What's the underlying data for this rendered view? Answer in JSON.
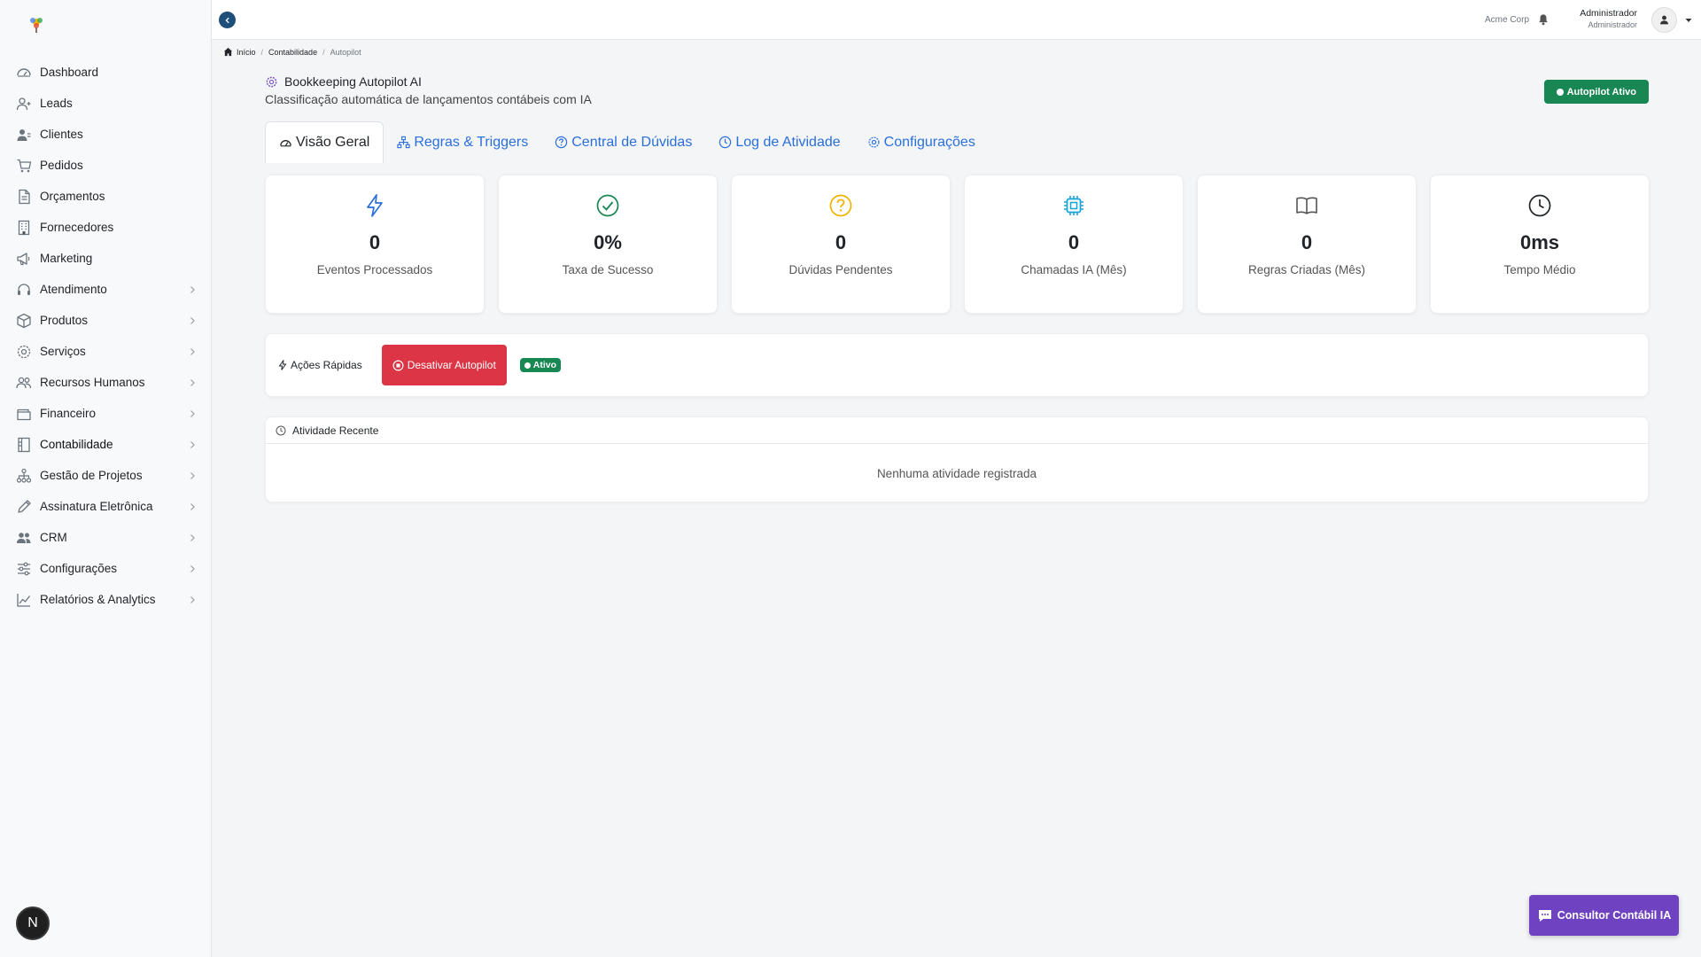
{
  "sidebar": {
    "items": [
      {
        "label": "Dashboard",
        "icon": "dashboard-icon",
        "has_submenu": false
      },
      {
        "label": "Leads",
        "icon": "user-plus-icon",
        "has_submenu": false
      },
      {
        "label": "Clientes",
        "icon": "users-icon",
        "has_submenu": false
      },
      {
        "label": "Pedidos",
        "icon": "cart-icon",
        "has_submenu": false
      },
      {
        "label": "Orçamentos",
        "icon": "document-icon",
        "has_submenu": false
      },
      {
        "label": "Fornecedores",
        "icon": "building-icon",
        "has_submenu": false
      },
      {
        "label": "Marketing",
        "icon": "megaphone-icon",
        "has_submenu": false
      },
      {
        "label": "Atendimento",
        "icon": "headset-icon",
        "has_submenu": true
      },
      {
        "label": "Produtos",
        "icon": "box-icon",
        "has_submenu": true
      },
      {
        "label": "Serviços",
        "icon": "gear-icon",
        "has_submenu": true
      },
      {
        "label": "Recursos Humanos",
        "icon": "people-icon",
        "has_submenu": true
      },
      {
        "label": "Financeiro",
        "icon": "wallet-icon",
        "has_submenu": true
      },
      {
        "label": "Contabilidade",
        "icon": "ledger-icon",
        "has_submenu": true
      },
      {
        "label": "Gestão de Projetos",
        "icon": "diagram-icon",
        "has_submenu": true
      },
      {
        "label": "Assinatura Eletrônica",
        "icon": "pen-icon",
        "has_submenu": true
      },
      {
        "label": "CRM",
        "icon": "crm-icon",
        "has_submenu": true
      },
      {
        "label": "Configurações",
        "icon": "sliders-icon",
        "has_submenu": true
      },
      {
        "label": "Relatórios & Analytics",
        "icon": "chart-icon",
        "has_submenu": true
      }
    ],
    "active_index": 12,
    "bottom_badge": "N"
  },
  "topbar": {
    "company": "Acme Corp",
    "user_name": "Administrador",
    "user_role": "Administrador"
  },
  "breadcrumb": {
    "home": "Início",
    "section": "Contabilidade",
    "current": "Autopilot"
  },
  "header": {
    "title": "Bookkeeping Autopilot AI",
    "subtitle": "Classificação automática de lançamentos contábeis com IA",
    "status": "Autopilot Ativo"
  },
  "tabs": [
    {
      "label": "Visão Geral",
      "active": true
    },
    {
      "label": "Regras & Triggers",
      "active": false
    },
    {
      "label": "Central de Dúvidas",
      "active": false
    },
    {
      "label": "Log de Atividade",
      "active": false
    },
    {
      "label": "Configurações",
      "active": false
    }
  ],
  "stats": [
    {
      "value": "0",
      "label": "Eventos Processados",
      "icon": "bolt-icon",
      "color": "#2a6fdb"
    },
    {
      "value": "0%",
      "label": "Taxa de Sucesso",
      "icon": "check-circle-icon",
      "color": "#198754"
    },
    {
      "value": "0",
      "label": "Dúvidas Pendentes",
      "icon": "question-circle-icon",
      "color": "#f0b400"
    },
    {
      "value": "0",
      "label": "Chamadas IA (Mês)",
      "icon": "cpu-icon",
      "color": "#17a2d8"
    },
    {
      "value": "0",
      "label": "Regras Criadas (Mês)",
      "icon": "book-icon",
      "color": "#555555"
    },
    {
      "value": "0ms",
      "label": "Tempo Médio",
      "icon": "clock-icon",
      "color": "#212529"
    }
  ],
  "quick_actions": {
    "label": "Ações Rápidas",
    "deactivate_button": "Desativar Autopilot",
    "status_badge": "Ativo"
  },
  "recent_activity": {
    "title": "Atividade Recente",
    "empty_message": "Nenhuma atividade registrada"
  },
  "ai_button": {
    "label": "Consultor Contábil IA"
  },
  "colors": {
    "success": "#198754",
    "danger": "#dc3545",
    "link": "#2a6fdb",
    "ai_purple": "#6f42c1"
  }
}
